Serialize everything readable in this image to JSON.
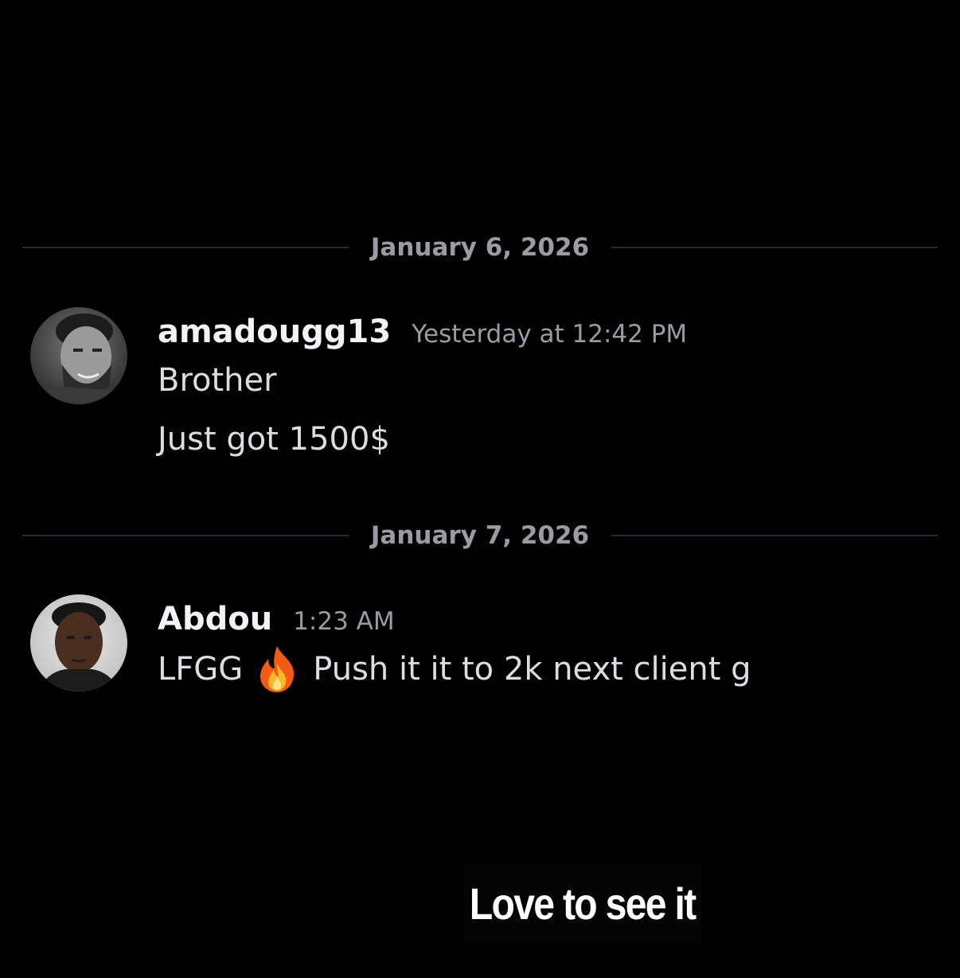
{
  "dividers": [
    {
      "date": "January 6, 2026"
    },
    {
      "date": "January 7, 2026"
    }
  ],
  "messages": [
    {
      "username": "amadougg13",
      "timestamp": "Yesterday at 12:42 PM",
      "lines": [
        "Brother",
        "Just got 1500$"
      ],
      "avatar_icon": "bearded-man-avatar"
    },
    {
      "username": "Abdou",
      "timestamp": "1:23 AM",
      "line_before_emoji": "LFGG",
      "emoji_icon": "fire-emoji-icon",
      "line_after_emoji": "Push it it to 2k next client g",
      "avatar_icon": "young-man-avatar"
    }
  ],
  "caption": "Love to see it",
  "colors": {
    "background": "#000000",
    "divider_line": "#2a2b31",
    "muted_text": "#9a9ba3",
    "username": "#f2f3f5",
    "message_text": "#dcdde1"
  }
}
